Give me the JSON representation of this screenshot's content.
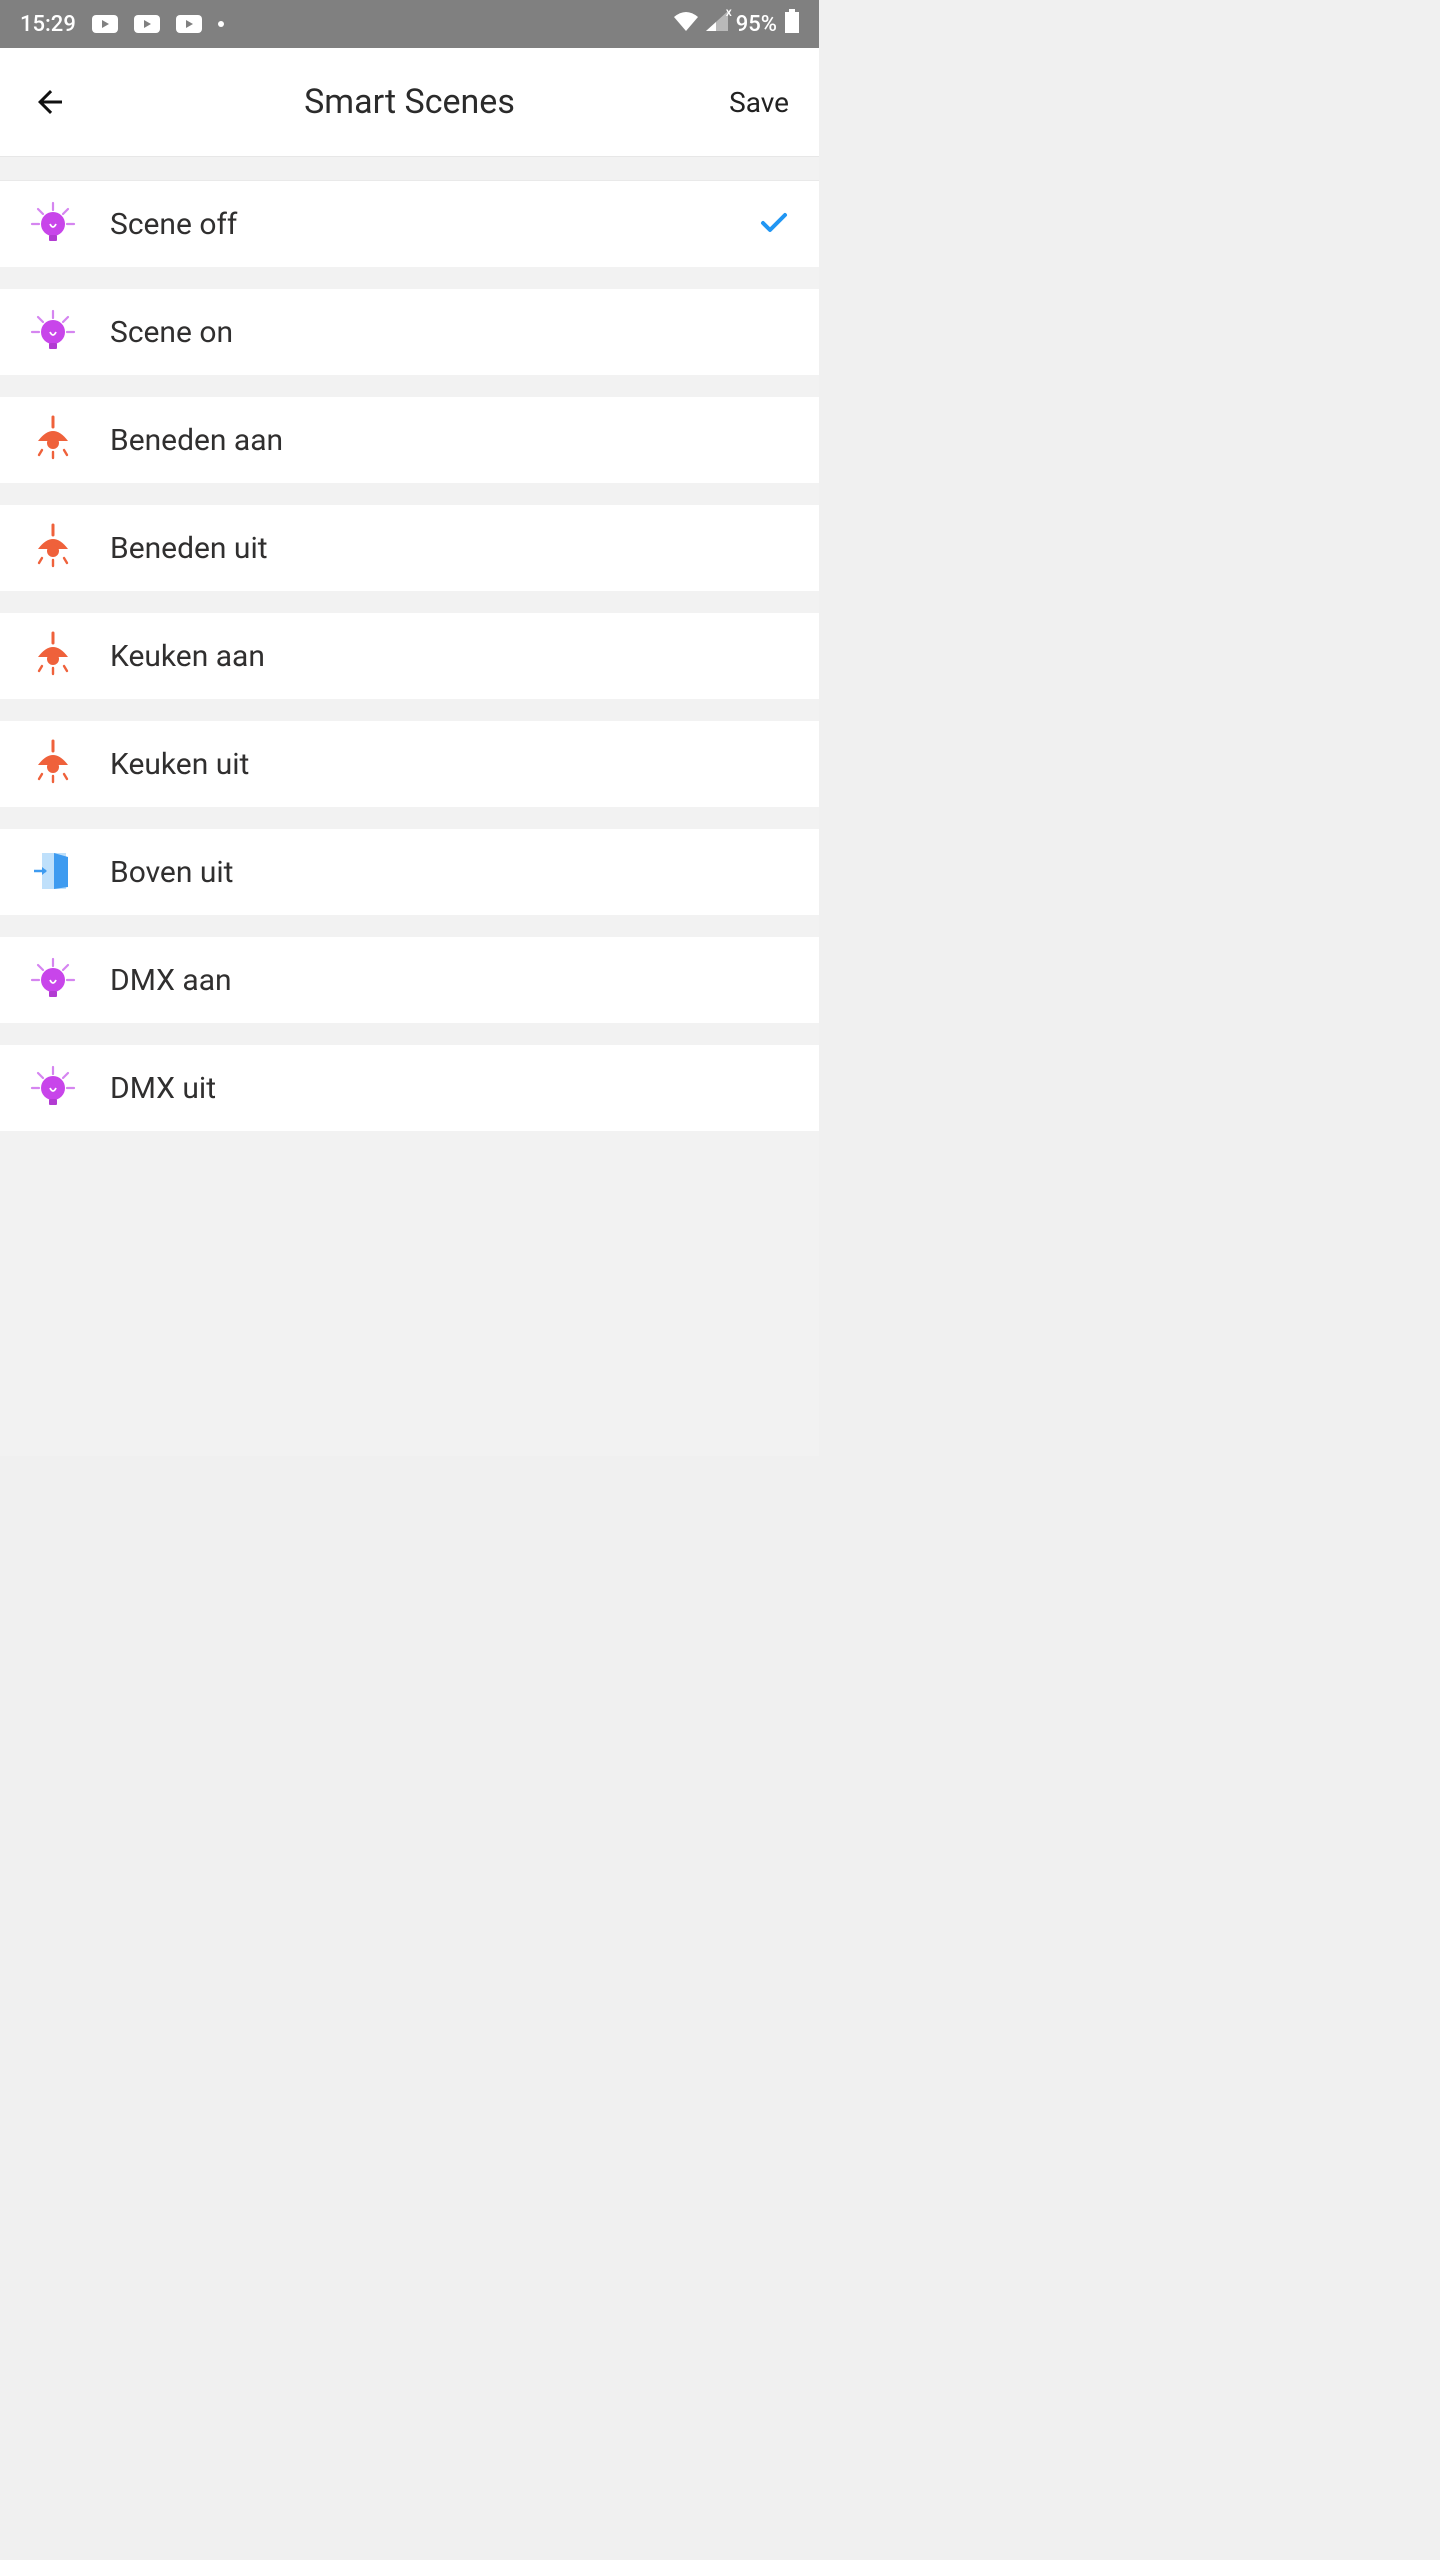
{
  "status": {
    "time": "15:29",
    "battery": "95%"
  },
  "header": {
    "title": "Smart Scenes",
    "save_label": "Save"
  },
  "scenes": [
    {
      "label": "Scene off",
      "icon": "bulb-purple",
      "selected": true
    },
    {
      "label": "Scene on",
      "icon": "bulb-purple",
      "selected": false
    },
    {
      "label": "Beneden aan",
      "icon": "lamp-orange",
      "selected": false
    },
    {
      "label": "Beneden uit",
      "icon": "lamp-orange",
      "selected": false
    },
    {
      "label": "Keuken aan",
      "icon": "lamp-orange",
      "selected": false
    },
    {
      "label": "Keuken uit",
      "icon": "lamp-orange",
      "selected": false
    },
    {
      "label": "Boven uit",
      "icon": "door-blue",
      "selected": false
    },
    {
      "label": "DMX aan",
      "icon": "bulb-purple",
      "selected": false
    },
    {
      "label": "DMX uit",
      "icon": "bulb-purple",
      "selected": false
    }
  ],
  "colors": {
    "purple": "#c845ea",
    "orange": "#ef613b",
    "blue": "#3e9bf0",
    "check": "#2196f3"
  }
}
